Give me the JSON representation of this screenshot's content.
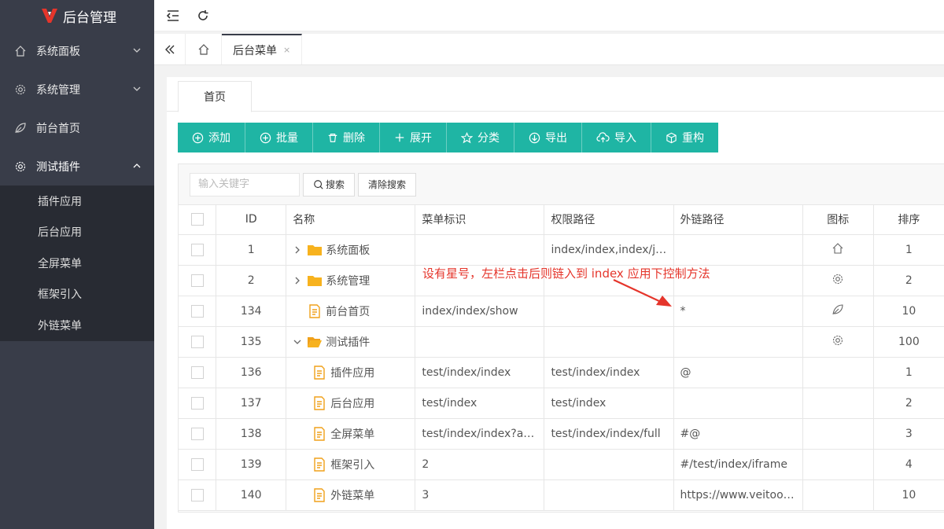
{
  "sidebar": {
    "brand": "后台管理",
    "items": [
      {
        "label": "系统面板"
      },
      {
        "label": "系统管理"
      },
      {
        "label": "前台首页"
      },
      {
        "label": "测试插件"
      }
    ],
    "subitems": [
      {
        "label": "插件应用"
      },
      {
        "label": "后台应用"
      },
      {
        "label": "全屏菜单"
      },
      {
        "label": "框架引入"
      },
      {
        "label": "外链菜单"
      }
    ]
  },
  "tabs": {
    "active_label": "后台菜单",
    "close_glyph": "×"
  },
  "content": {
    "tab_label": "首页",
    "toolbar": [
      "添加",
      "批量",
      "删除",
      "展开",
      "分类",
      "导出",
      "导入",
      "重构"
    ],
    "search": {
      "placeholder": "输入关键字",
      "search_label": "搜索",
      "clear_label": "清除搜索"
    },
    "columns": [
      "ID",
      "名称",
      "菜单标识",
      "权限路径",
      "外链路径",
      "图标",
      "排序"
    ],
    "rows": [
      {
        "id": "1",
        "name": "系统面板",
        "key": "",
        "perm": "index/index,index/jso...",
        "link": "",
        "order": "1"
      },
      {
        "id": "2",
        "name": "系统管理",
        "key": "",
        "perm": "",
        "link": "",
        "order": "2"
      },
      {
        "id": "134",
        "name": "前台首页",
        "key": "index/index/show",
        "perm": "",
        "link": "*",
        "order": "10"
      },
      {
        "id": "135",
        "name": "测试插件",
        "key": "",
        "perm": "",
        "link": "",
        "order": "100"
      },
      {
        "id": "136",
        "name": "插件应用",
        "key": "test/index/index",
        "perm": "test/index/index",
        "link": "@",
        "order": "1"
      },
      {
        "id": "137",
        "name": "后台应用",
        "key": "test/index",
        "perm": "test/index",
        "link": "",
        "order": "2"
      },
      {
        "id": "138",
        "name": "全屏菜单",
        "key": "test/index/index?acti...",
        "perm": "test/index/index/full",
        "link": "#@",
        "order": "3"
      },
      {
        "id": "139",
        "name": "框架引入",
        "key": "2",
        "perm": "",
        "link": "#/test/index/iframe",
        "order": "4"
      },
      {
        "id": "140",
        "name": "外链菜单",
        "key": "3",
        "perm": "",
        "link": "https://www.veitool.com",
        "order": "10"
      }
    ]
  },
  "annotation": "设有星号，左栏点击后则链入到 index 应用下控制方法"
}
